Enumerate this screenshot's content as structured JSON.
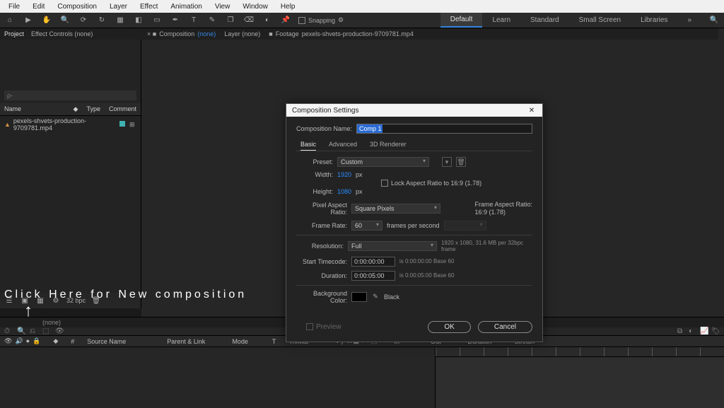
{
  "menu": [
    "File",
    "Edit",
    "Composition",
    "Layer",
    "Effect",
    "Animation",
    "View",
    "Window",
    "Help"
  ],
  "snapping_label": "Snapping",
  "workspaces": [
    "Default",
    "Learn",
    "Standard",
    "Small Screen",
    "Libraries"
  ],
  "active_workspace": "Default",
  "left_panel_tabs": [
    "Project",
    "Effect Controls (none)"
  ],
  "project": {
    "search_placeholder": "ρ-",
    "col_name": "Name",
    "col_type": "Type",
    "col_comment": "Comment",
    "rows": [
      {
        "name": "pexels-shvets-production-9709781.mp4"
      }
    ],
    "footer_bpc": "32 bpc"
  },
  "center_tabs": {
    "composition_label": "Composition",
    "composition_value": "(none)",
    "layer_label": "Layer (none)",
    "footage_label": "Footage",
    "footage_value": "pexels-shvets-production-9709781.mp4"
  },
  "timeline": {
    "sub_header": "(none)",
    "cols": [
      "Source Name",
      "Parent & Link",
      "Mode",
      "T",
      "TrkMat",
      "In",
      "Out",
      "Duration",
      "Stretch"
    ]
  },
  "overlay_text": "Click Here for New composition",
  "dialog": {
    "title": "Composition Settings",
    "name_label": "Composition Name:",
    "name_value": "Comp 1",
    "tabs": [
      "Basic",
      "Advanced",
      "3D Renderer"
    ],
    "preset_label": "Preset:",
    "preset_value": "Custom",
    "width_label": "Width:",
    "width_value": "1920",
    "height_label": "Height:",
    "height_value": "1080",
    "px": "px",
    "lock_label": "Lock Aspect Ratio to 16:9 (1.78)",
    "par_label": "Pixel Aspect Ratio:",
    "par_value": "Square Pixels",
    "frame_aspect_label": "Frame Aspect Ratio:",
    "frame_aspect_value": "16:9 (1.78)",
    "fps_label": "Frame Rate:",
    "fps_value": "60",
    "fps_unit": "frames per second",
    "res_label": "Resolution:",
    "res_value": "Full",
    "res_note": "1920 x 1080, 31.6 MB per 32bpc frame",
    "start_label": "Start Timecode:",
    "start_value": "0:00:00:00",
    "start_note": "is 0:00:00:00 Base 60",
    "dur_label": "Duration:",
    "dur_value": "0:00:05:00",
    "dur_note": "is 0:00:05:00 Base 60",
    "bg_label": "Background Color:",
    "bg_name": "Black",
    "preview": "Preview",
    "ok": "OK",
    "cancel": "Cancel"
  }
}
